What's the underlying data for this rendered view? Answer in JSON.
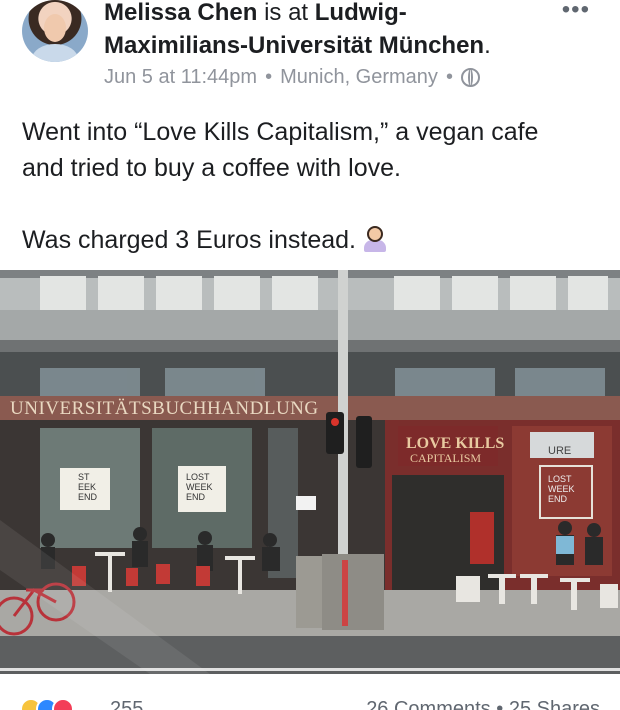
{
  "post": {
    "author": "Melissa Chen",
    "connector": "is at",
    "place": "Ludwig-Maximilians-Universität München",
    "period": ".",
    "date": "Jun 5 at 11:44pm",
    "location": "Munich, Germany",
    "separator": "•",
    "privacy_icon": "globe-icon",
    "more_label": "•••",
    "text_line1": "Went into “Love Kills Capitalism,” a vegan cafe",
    "text_line2": "and tried to buy a coffee with love.",
    "text_line3": "Was charged 3 Euros instead.",
    "text_emoji": "woman-tipping-hand-emoji"
  },
  "photo": {
    "store_sign": "UNIVERSITÄTSBUCHHANDLUNG",
    "cafe_sign_line1": "LOVE KILLS",
    "cafe_sign_line2": "CAPITALISM",
    "poster_left": [
      "ST",
      "EEK",
      "END"
    ],
    "poster_mid": [
      "LOST",
      "WEEK",
      "END"
    ],
    "poster_right": [
      "LOST",
      "WEEK",
      "END"
    ],
    "window_right_text": "URE",
    "colors": {
      "facade": "#9a9c9a",
      "brick": "#7a2e2c",
      "sign_bg": "#7d2a2a",
      "sign_text": "#e8c9a0"
    }
  },
  "footer": {
    "reaction_count": "255",
    "comments": "26 Comments",
    "shares": "25 Shares",
    "separator": "•",
    "reaction_icons": [
      "haha-icon",
      "like-icon",
      "love-icon"
    ]
  }
}
